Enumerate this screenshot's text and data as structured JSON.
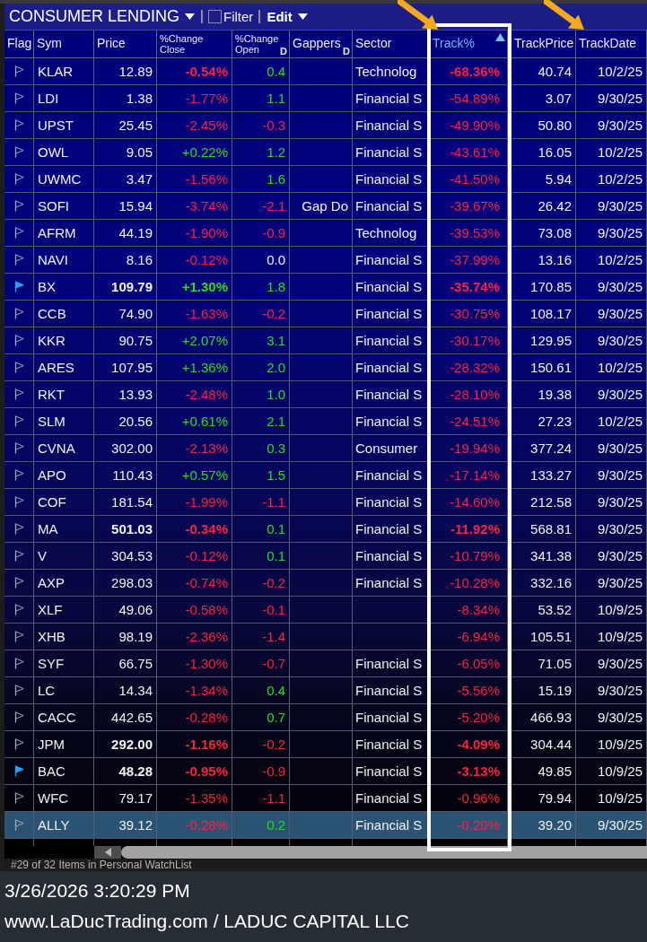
{
  "toolbar": {
    "title": "CONSUMER LENDING",
    "filter": {
      "label": "Filter",
      "checked": false
    },
    "menu": "Edit"
  },
  "table": {
    "columns": [
      {
        "label": "Flag",
        "sorted": false,
        "framed": false,
        "arrow": false
      },
      {
        "label": "Sym",
        "sorted": false,
        "framed": false,
        "arrow": false
      },
      {
        "label": "Price",
        "sorted": false,
        "framed": false,
        "arrow": false
      },
      {
        "label": "%Change Close",
        "sorted": false,
        "framed": false,
        "arrow": false
      },
      {
        "label": "%Change Open",
        "marker": "D",
        "sorted": false,
        "framed": false,
        "arrow": false
      },
      {
        "label": "Gappers",
        "marker": "D",
        "sorted": false,
        "framed": false,
        "arrow": false
      },
      {
        "label": "Sector",
        "sorted": false,
        "framed": false,
        "arrow": false
      },
      {
        "label": "Track%",
        "sorted": true,
        "framed": true,
        "arrow": true
      },
      {
        "label": "TrackPrice",
        "sorted": false,
        "framed": false,
        "arrow": false
      },
      {
        "label": "TrackDate",
        "sorted": false,
        "framed": false,
        "arrow": true
      }
    ],
    "rows": [
      {
        "flagged": false,
        "selected": false,
        "sym": "KLAR",
        "price": {
          "text": "12.89",
          "emphasis": false
        },
        "change_close": {
          "text": "-0.54%",
          "gain": false,
          "loss": true,
          "emphasis": true
        },
        "change_open": {
          "text": "0.4",
          "gain": true,
          "loss": false
        },
        "sector": "Technolog",
        "track_pct": {
          "text": "-68.36%",
          "gain": false,
          "loss": true,
          "emphasis": true
        },
        "track_price": "40.74",
        "track_date": "10/2/25"
      },
      {
        "flagged": false,
        "selected": false,
        "sym": "LDI",
        "price": {
          "text": "1.38",
          "emphasis": false
        },
        "change_close": {
          "text": "-1.77%",
          "gain": false,
          "loss": true,
          "emphasis": false
        },
        "change_open": {
          "text": "1.1",
          "gain": true,
          "loss": false
        },
        "sector": "Financial S",
        "track_pct": {
          "text": "-54.89%",
          "gain": false,
          "loss": true,
          "emphasis": false
        },
        "track_price": "3.07",
        "track_date": "9/30/25"
      },
      {
        "flagged": false,
        "selected": false,
        "sym": "UPST",
        "price": {
          "text": "25.45",
          "emphasis": false
        },
        "change_close": {
          "text": "-2.45%",
          "gain": false,
          "loss": true,
          "emphasis": false
        },
        "change_open": {
          "text": "-0.3",
          "gain": false,
          "loss": true
        },
        "sector": "Financial S",
        "track_pct": {
          "text": "-49.90%",
          "gain": false,
          "loss": true,
          "emphasis": false
        },
        "track_price": "50.80",
        "track_date": "9/30/25"
      },
      {
        "flagged": false,
        "selected": false,
        "sym": "OWL",
        "price": {
          "text": "9.05",
          "emphasis": false
        },
        "change_close": {
          "text": "+0.22%",
          "gain": true,
          "loss": false,
          "emphasis": false
        },
        "change_open": {
          "text": "1.2",
          "gain": true,
          "loss": false
        },
        "sector": "Financial S",
        "track_pct": {
          "text": "-43.61%",
          "gain": false,
          "loss": true,
          "emphasis": false
        },
        "track_price": "16.05",
        "track_date": "10/2/25"
      },
      {
        "flagged": false,
        "selected": false,
        "sym": "UWMC",
        "price": {
          "text": "3.47",
          "emphasis": false
        },
        "change_close": {
          "text": "-1.56%",
          "gain": false,
          "loss": true,
          "emphasis": false
        },
        "change_open": {
          "text": "1.6",
          "gain": true,
          "loss": false
        },
        "sector": "Financial S",
        "track_pct": {
          "text": "-41.50%",
          "gain": false,
          "loss": true,
          "emphasis": false
        },
        "track_price": "5.94",
        "track_date": "10/2/25"
      },
      {
        "flagged": false,
        "selected": false,
        "sym": "SOFI",
        "price": {
          "text": "15.94",
          "emphasis": false
        },
        "change_close": {
          "text": "-3.74%",
          "gain": false,
          "loss": true,
          "emphasis": false
        },
        "change_open": {
          "text": "-2.1",
          "gain": false,
          "loss": true
        },
        "gappers": "Gap Do",
        "sector": "Financial S",
        "track_pct": {
          "text": "-39.67%",
          "gain": false,
          "loss": true,
          "emphasis": false
        },
        "track_price": "26.42",
        "track_date": "9/30/25"
      },
      {
        "flagged": false,
        "selected": false,
        "sym": "AFRM",
        "price": {
          "text": "44.19",
          "emphasis": false
        },
        "change_close": {
          "text": "-1.90%",
          "gain": false,
          "loss": true,
          "emphasis": false
        },
        "change_open": {
          "text": "-0.9",
          "gain": false,
          "loss": true
        },
        "sector": "Technolog",
        "track_pct": {
          "text": "-39.53%",
          "gain": false,
          "loss": true,
          "emphasis": false
        },
        "track_price": "73.08",
        "track_date": "9/30/25"
      },
      {
        "flagged": false,
        "selected": false,
        "sym": "NAVI",
        "price": {
          "text": "8.16",
          "emphasis": false
        },
        "change_close": {
          "text": "-0.12%",
          "gain": false,
          "loss": true,
          "emphasis": false
        },
        "change_open": {
          "text": "0.0",
          "gain": false,
          "loss": false
        },
        "sector": "Financial S",
        "track_pct": {
          "text": "-37.99%",
          "gain": false,
          "loss": true,
          "emphasis": false
        },
        "track_price": "13.16",
        "track_date": "10/2/25"
      },
      {
        "flagged": true,
        "selected": false,
        "sym": "BX",
        "price": {
          "text": "109.79",
          "emphasis": true
        },
        "change_close": {
          "text": "+1.30%",
          "gain": true,
          "loss": false,
          "emphasis": true
        },
        "change_open": {
          "text": "1.8",
          "gain": true,
          "loss": false
        },
        "sector": "Financial S",
        "track_pct": {
          "text": "-35.74%",
          "gain": false,
          "loss": true,
          "emphasis": true
        },
        "track_price": "170.85",
        "track_date": "9/30/25"
      },
      {
        "flagged": false,
        "selected": false,
        "sym": "CCB",
        "price": {
          "text": "74.90",
          "emphasis": false
        },
        "change_close": {
          "text": "-1.63%",
          "gain": false,
          "loss": true,
          "emphasis": false
        },
        "change_open": {
          "text": "-0.2",
          "gain": false,
          "loss": true
        },
        "sector": "Financial S",
        "track_pct": {
          "text": "-30.75%",
          "gain": false,
          "loss": true,
          "emphasis": false
        },
        "track_price": "108.17",
        "track_date": "9/30/25"
      },
      {
        "flagged": false,
        "selected": false,
        "sym": "KKR",
        "price": {
          "text": "90.75",
          "emphasis": false
        },
        "change_close": {
          "text": "+2.07%",
          "gain": true,
          "loss": false,
          "emphasis": false
        },
        "change_open": {
          "text": "3.1",
          "gain": true,
          "loss": false
        },
        "sector": "Financial S",
        "track_pct": {
          "text": "-30.17%",
          "gain": false,
          "loss": true,
          "emphasis": false
        },
        "track_price": "129.95",
        "track_date": "9/30/25"
      },
      {
        "flagged": false,
        "selected": false,
        "sym": "ARES",
        "price": {
          "text": "107.95",
          "emphasis": false
        },
        "change_close": {
          "text": "+1.36%",
          "gain": true,
          "loss": false,
          "emphasis": false
        },
        "change_open": {
          "text": "2.0",
          "gain": true,
          "loss": false
        },
        "sector": "Financial S",
        "track_pct": {
          "text": "-28.32%",
          "gain": false,
          "loss": true,
          "emphasis": false
        },
        "track_price": "150.61",
        "track_date": "10/2/25"
      },
      {
        "flagged": false,
        "selected": false,
        "sym": "RKT",
        "price": {
          "text": "13.93",
          "emphasis": false
        },
        "change_close": {
          "text": "-2.48%",
          "gain": false,
          "loss": true,
          "emphasis": false
        },
        "change_open": {
          "text": "1.0",
          "gain": true,
          "loss": false
        },
        "sector": "Financial S",
        "track_pct": {
          "text": "-28.10%",
          "gain": false,
          "loss": true,
          "emphasis": false
        },
        "track_price": "19.38",
        "track_date": "9/30/25"
      },
      {
        "flagged": false,
        "selected": false,
        "sym": "SLM",
        "price": {
          "text": "20.56",
          "emphasis": false
        },
        "change_close": {
          "text": "+0.61%",
          "gain": true,
          "loss": false,
          "emphasis": false
        },
        "change_open": {
          "text": "2.1",
          "gain": true,
          "loss": false
        },
        "sector": "Financial S",
        "track_pct": {
          "text": "-24.51%",
          "gain": false,
          "loss": true,
          "emphasis": false
        },
        "track_price": "27.23",
        "track_date": "10/2/25"
      },
      {
        "flagged": false,
        "selected": false,
        "sym": "CVNA",
        "price": {
          "text": "302.00",
          "emphasis": false
        },
        "change_close": {
          "text": "-2.13%",
          "gain": false,
          "loss": true,
          "emphasis": false
        },
        "change_open": {
          "text": "0.3",
          "gain": true,
          "loss": false
        },
        "sector": "Consumer",
        "track_pct": {
          "text": "-19.94%",
          "gain": false,
          "loss": true,
          "emphasis": false
        },
        "track_price": "377.24",
        "track_date": "9/30/25"
      },
      {
        "flagged": false,
        "selected": false,
        "sym": "APO",
        "price": {
          "text": "110.43",
          "emphasis": false
        },
        "change_close": {
          "text": "+0.57%",
          "gain": true,
          "loss": false,
          "emphasis": false
        },
        "change_open": {
          "text": "1.5",
          "gain": true,
          "loss": false
        },
        "sector": "Financial S",
        "track_pct": {
          "text": "-17.14%",
          "gain": false,
          "loss": true,
          "emphasis": false
        },
        "track_price": "133.27",
        "track_date": "9/30/25"
      },
      {
        "flagged": false,
        "selected": false,
        "sym": "COF",
        "price": {
          "text": "181.54",
          "emphasis": false
        },
        "change_close": {
          "text": "-1.99%",
          "gain": false,
          "loss": true,
          "emphasis": false
        },
        "change_open": {
          "text": "-1.1",
          "gain": false,
          "loss": true
        },
        "sector": "Financial S",
        "track_pct": {
          "text": "-14.60%",
          "gain": false,
          "loss": true,
          "emphasis": false
        },
        "track_price": "212.58",
        "track_date": "9/30/25"
      },
      {
        "flagged": false,
        "selected": false,
        "sym": "MA",
        "price": {
          "text": "501.03",
          "emphasis": true
        },
        "change_close": {
          "text": "-0.34%",
          "gain": false,
          "loss": true,
          "emphasis": true
        },
        "change_open": {
          "text": "0.1",
          "gain": true,
          "loss": false
        },
        "sector": "Financial S",
        "track_pct": {
          "text": "-11.92%",
          "gain": false,
          "loss": true,
          "emphasis": true
        },
        "track_price": "568.81",
        "track_date": "9/30/25"
      },
      {
        "flagged": false,
        "selected": false,
        "sym": "V",
        "price": {
          "text": "304.53",
          "emphasis": false
        },
        "change_close": {
          "text": "-0.12%",
          "gain": false,
          "loss": true,
          "emphasis": false
        },
        "change_open": {
          "text": "0.1",
          "gain": true,
          "loss": false
        },
        "sector": "Financial S",
        "track_pct": {
          "text": "-10.79%",
          "gain": false,
          "loss": true,
          "emphasis": false
        },
        "track_price": "341.38",
        "track_date": "9/30/25"
      },
      {
        "flagged": false,
        "selected": false,
        "sym": "AXP",
        "price": {
          "text": "298.03",
          "emphasis": false
        },
        "change_close": {
          "text": "-0.74%",
          "gain": false,
          "loss": true,
          "emphasis": false
        },
        "change_open": {
          "text": "-0.2",
          "gain": false,
          "loss": true
        },
        "sector": "Financial S",
        "track_pct": {
          "text": "-10.28%",
          "gain": false,
          "loss": true,
          "emphasis": false
        },
        "track_price": "332.16",
        "track_date": "9/30/25"
      },
      {
        "flagged": false,
        "selected": false,
        "sym": "XLF",
        "price": {
          "text": "49.06",
          "emphasis": false
        },
        "change_close": {
          "text": "-0.58%",
          "gain": false,
          "loss": true,
          "emphasis": false
        },
        "change_open": {
          "text": "-0.1",
          "gain": false,
          "loss": true
        },
        "track_pct": {
          "text": "-8.34%",
          "gain": false,
          "loss": true,
          "emphasis": false
        },
        "track_price": "53.52",
        "track_date": "10/9/25"
      },
      {
        "flagged": false,
        "selected": false,
        "sym": "XHB",
        "price": {
          "text": "98.19",
          "emphasis": false
        },
        "change_close": {
          "text": "-2.36%",
          "gain": false,
          "loss": true,
          "emphasis": false
        },
        "change_open": {
          "text": "-1.4",
          "gain": false,
          "loss": true
        },
        "track_pct": {
          "text": "-6.94%",
          "gain": false,
          "loss": true,
          "emphasis": false
        },
        "track_price": "105.51",
        "track_date": "10/9/25"
      },
      {
        "flagged": false,
        "selected": false,
        "sym": "SYF",
        "price": {
          "text": "66.75",
          "emphasis": false
        },
        "change_close": {
          "text": "-1.30%",
          "gain": false,
          "loss": true,
          "emphasis": false
        },
        "change_open": {
          "text": "-0.7",
          "gain": false,
          "loss": true
        },
        "sector": "Financial S",
        "track_pct": {
          "text": "-6.05%",
          "gain": false,
          "loss": true,
          "emphasis": false
        },
        "track_price": "71.05",
        "track_date": "9/30/25"
      },
      {
        "flagged": false,
        "selected": false,
        "sym": "LC",
        "price": {
          "text": "14.34",
          "emphasis": false
        },
        "change_close": {
          "text": "-1.34%",
          "gain": false,
          "loss": true,
          "emphasis": false
        },
        "change_open": {
          "text": "0.4",
          "gain": true,
          "loss": false
        },
        "sector": "Financial S",
        "track_pct": {
          "text": "-5.56%",
          "gain": false,
          "loss": true,
          "emphasis": false
        },
        "track_price": "15.19",
        "track_date": "9/30/25"
      },
      {
        "flagged": false,
        "selected": false,
        "sym": "CACC",
        "price": {
          "text": "442.65",
          "emphasis": false
        },
        "change_close": {
          "text": "-0.28%",
          "gain": false,
          "loss": true,
          "emphasis": false
        },
        "change_open": {
          "text": "0.7",
          "gain": true,
          "loss": false
        },
        "sector": "Financial S",
        "track_pct": {
          "text": "-5.20%",
          "gain": false,
          "loss": true,
          "emphasis": false
        },
        "track_price": "466.93",
        "track_date": "9/30/25"
      },
      {
        "flagged": false,
        "selected": false,
        "sym": "JPM",
        "price": {
          "text": "292.00",
          "emphasis": true
        },
        "change_close": {
          "text": "-1.16%",
          "gain": false,
          "loss": true,
          "emphasis": true
        },
        "change_open": {
          "text": "-0.2",
          "gain": false,
          "loss": true
        },
        "sector": "Financial S",
        "track_pct": {
          "text": "-4.09%",
          "gain": false,
          "loss": true,
          "emphasis": true
        },
        "track_price": "304.44",
        "track_date": "10/9/25"
      },
      {
        "flagged": true,
        "selected": false,
        "sym": "BAC",
        "price": {
          "text": "48.28",
          "emphasis": true
        },
        "change_close": {
          "text": "-0.95%",
          "gain": false,
          "loss": true,
          "emphasis": true
        },
        "change_open": {
          "text": "-0.9",
          "gain": false,
          "loss": true
        },
        "sector": "Financial S",
        "track_pct": {
          "text": "-3.13%",
          "gain": false,
          "loss": true,
          "emphasis": true
        },
        "track_price": "49.85",
        "track_date": "10/9/25"
      },
      {
        "flagged": false,
        "selected": false,
        "sym": "WFC",
        "price": {
          "text": "79.17",
          "emphasis": false
        },
        "change_close": {
          "text": "-1.35%",
          "gain": false,
          "loss": true,
          "emphasis": false
        },
        "change_open": {
          "text": "-1.1",
          "gain": false,
          "loss": true
        },
        "sector": "Financial S",
        "track_pct": {
          "text": "-0.96%",
          "gain": false,
          "loss": true,
          "emphasis": false
        },
        "track_price": "79.94",
        "track_date": "10/9/25"
      },
      {
        "flagged": false,
        "selected": true,
        "sym": "ALLY",
        "price": {
          "text": "39.12",
          "emphasis": false
        },
        "change_close": {
          "text": "-0.28%",
          "gain": false,
          "loss": true,
          "emphasis": false
        },
        "change_open": {
          "text": "0.2",
          "gain": true,
          "loss": false
        },
        "sector": "Financial S",
        "track_pct": {
          "text": "-0.20%",
          "gain": false,
          "loss": true,
          "emphasis": false
        },
        "track_price": "39.20",
        "track_date": "9/30/25"
      }
    ]
  },
  "status_bar": "#29 of 32 Items in Personal WatchList",
  "caption": {
    "timestamp": "3/26/2026 3:20:29 PM",
    "credit": "www.LaDucTrading.com / LADUC CAPITAL LLC"
  }
}
